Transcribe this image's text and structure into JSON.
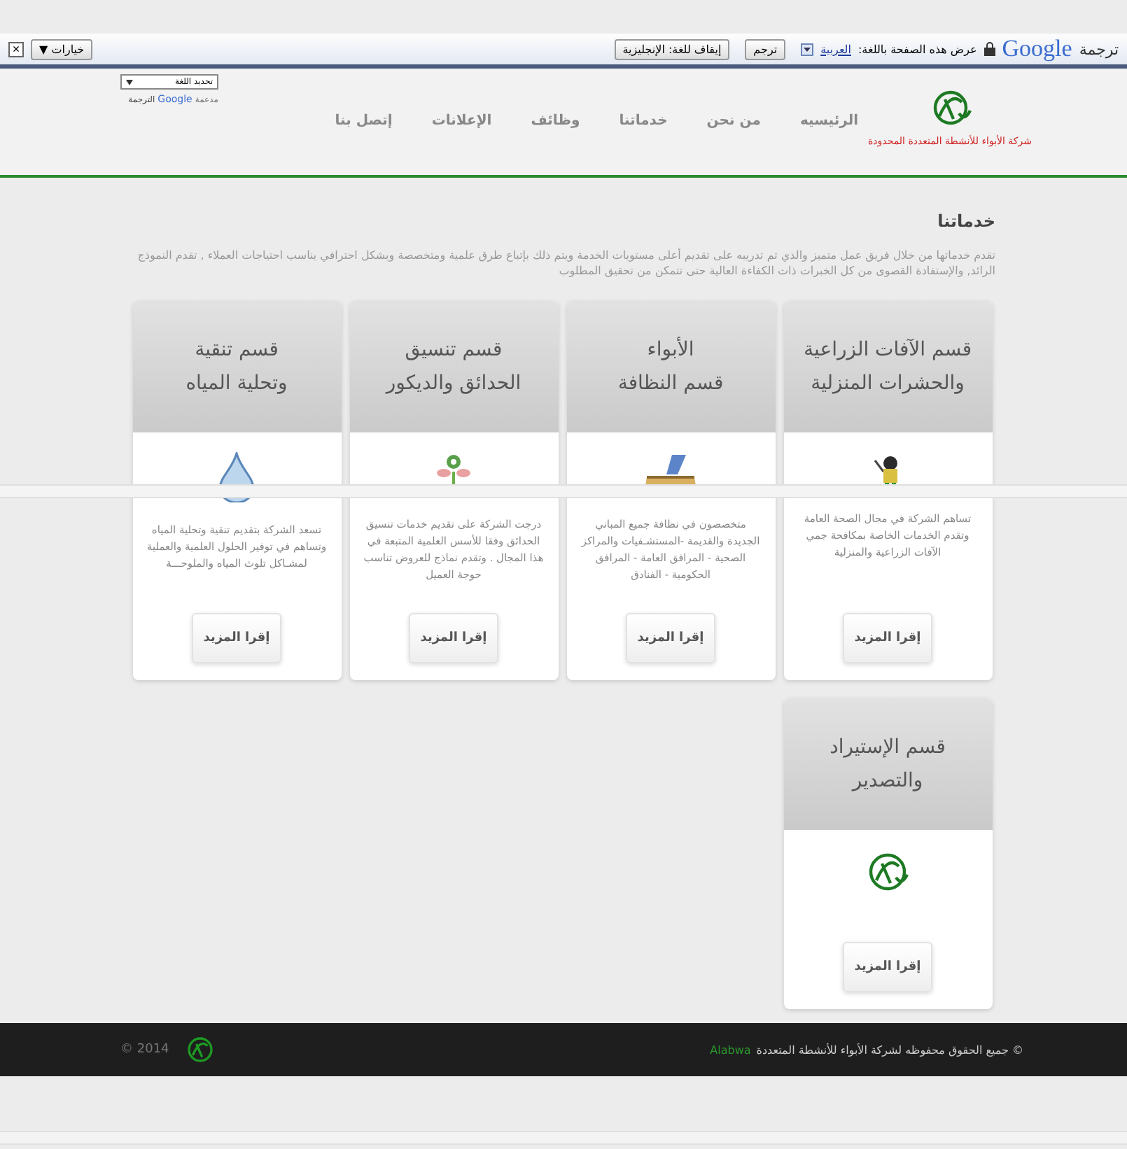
{
  "translate_bar": {
    "title": "ترجمة",
    "brand": "Google",
    "prompt": "عرض هذه الصفحة باللغة:",
    "language": "العربية",
    "translate_button": "ترجم",
    "turn_off_button": "إيقاف للغة: الإنجليزية",
    "options_button": "خيارات ▼",
    "close": "×"
  },
  "language_widget": {
    "select": "تحديد اللغة",
    "powered": "مدعمة",
    "brand": "Google",
    "product": "الترجمة"
  },
  "header": {
    "company": "شركة الأبواء للأنشطة المتعددة المحدودة",
    "nav": [
      "الرئيسيه",
      "من نحن",
      "خدماتنا",
      "وظائف",
      "الإعلانات",
      "إتصل بنا"
    ]
  },
  "section": {
    "title": "خدماتنا",
    "intro": "تقدم خدماتها من خلال فريق عمل متميز والذي تم تدريبه على تقديم أعلى مستويات الخدمة ويتم ذلك بإتباع طرق علمية ومتخصصة وبشكل احترافي يناسب احتياجات العملاء , تقدم النموذج الرائد, والإستفادة القصوى من كل الخبرات ذات الكفاءة العالية حتى تتمكن من تحقيق المطلوب"
  },
  "services": [
    {
      "title": [
        "قسم الآفات الزراعية",
        "والحشرات المنزلية"
      ],
      "kind": "pest",
      "description": "تساهم الشركة في مجال الصحة العامة وتقدم الخدمات الخاصة بمكافحة جمي الآفات الزراعية والمنزلية",
      "button": "إقرا المزيد"
    },
    {
      "title": [
        "الأبواء",
        "قسم النظافة"
      ],
      "kind": "broom",
      "description": "متخصصون في نظافة جميع المباني الجديدة والقديمة -المستشـفيات والمراكز الصحية - المرافق العامة - المرافق الحكومية - الفنادق",
      "button": "إقرا المزيد"
    },
    {
      "title": [
        "قسم تنسيق",
        "الحدائق والديكور"
      ],
      "kind": "plant",
      "description": "درجت الشركة على تقديم خدمات تنسيق الحدائق وفقا للأسس العلمية المتبعة في هذا المجال . وتقدم نماذج للعروض تناسب حوجة العميل",
      "button": "إقرا المزيد"
    },
    {
      "title": [
        "قسم تنقية",
        "وتحلية المياه"
      ],
      "kind": "drop",
      "description": "تسعد الشركة بتقديم تنقية وتحلية المياه وتساهم في توفير الحلول العلمية والعملية لمشـاكل تلوث المياه والملوحـــة",
      "button": "إقرا المزيد"
    },
    {
      "title": [
        "قسم الإستيراد",
        "والتصدير"
      ],
      "kind": "logo",
      "button": "إقرا المزيد"
    }
  ],
  "footer": {
    "copyright": "© جميع الحقوق محفوظه لشركة الأبواء للأنشطة المتعددة",
    "brand": "Alabwa",
    "year": "2014 ©"
  }
}
